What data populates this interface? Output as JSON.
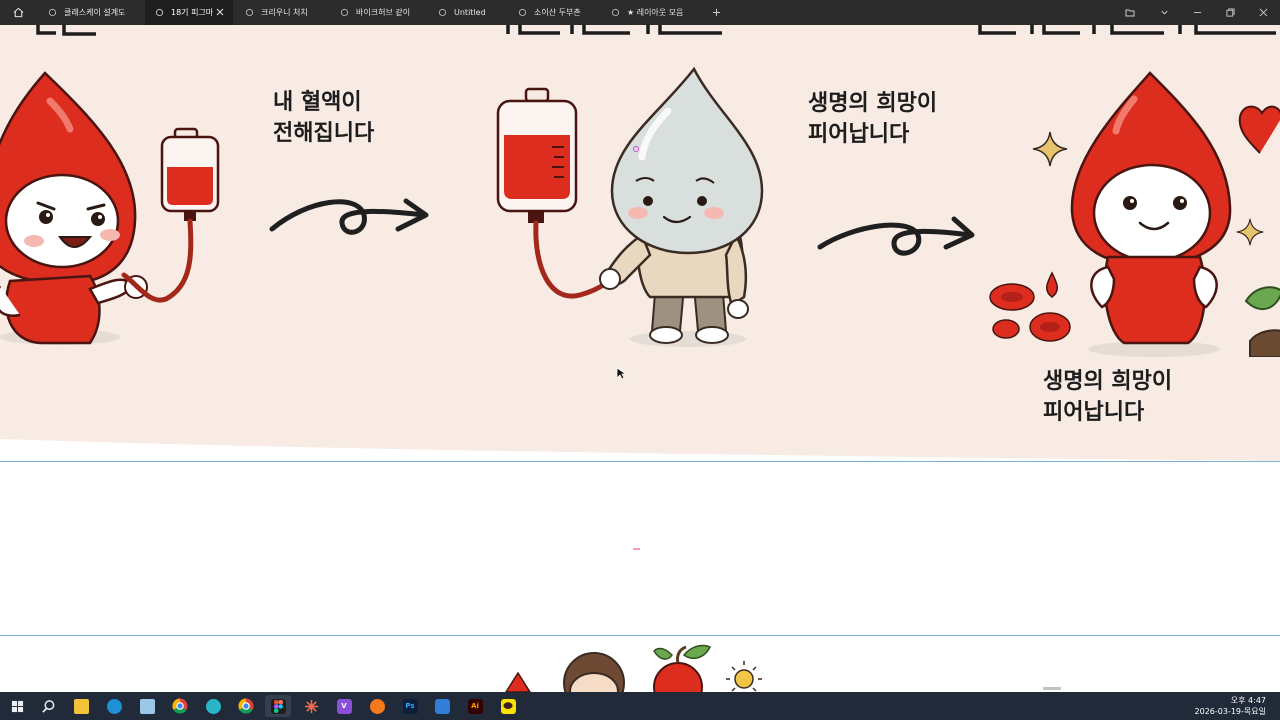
{
  "tabs": [
    {
      "title": "클래스케이 설계도"
    },
    {
      "title": "18기 피그마"
    },
    {
      "title": "크리우니 처치"
    },
    {
      "title": "바이크허브 같이"
    },
    {
      "title": "Untitled"
    },
    {
      "title": "소이산 두부촌"
    },
    {
      "title": "★ 레이아웃 모음"
    }
  ],
  "canvas": {
    "step1_caption": [
      "내 혈액이",
      "전해집니다"
    ],
    "step2_caption": [
      "생명의 희망이",
      "피어납니다"
    ],
    "step3_caption": [
      "생명의 희망이",
      "피어납니다"
    ]
  },
  "taskbar": {
    "apps": [
      "start-icon",
      "search-icon",
      "file-explorer-icon",
      "edge-icon",
      "notepad-icon",
      "chrome-icon",
      "bird-app-icon",
      "chrome-profile-icon",
      "figma-icon",
      "spark-icon",
      "visual-studio-icon",
      "firefox-icon",
      "photoshop-icon",
      "editor-icon",
      "illustrator-icon",
      "kakaotalk-icon"
    ],
    "clock_time": "오후 4:47",
    "clock_date": "2026-03-19-목요일"
  },
  "colors": {
    "tabbar_bg": "#2c2c2c",
    "artboard_bg": "#f7ebe4",
    "blood_red": "#dc2d1e",
    "frame_border": "#7cb2d6",
    "taskbar_bg": "#202a39"
  }
}
